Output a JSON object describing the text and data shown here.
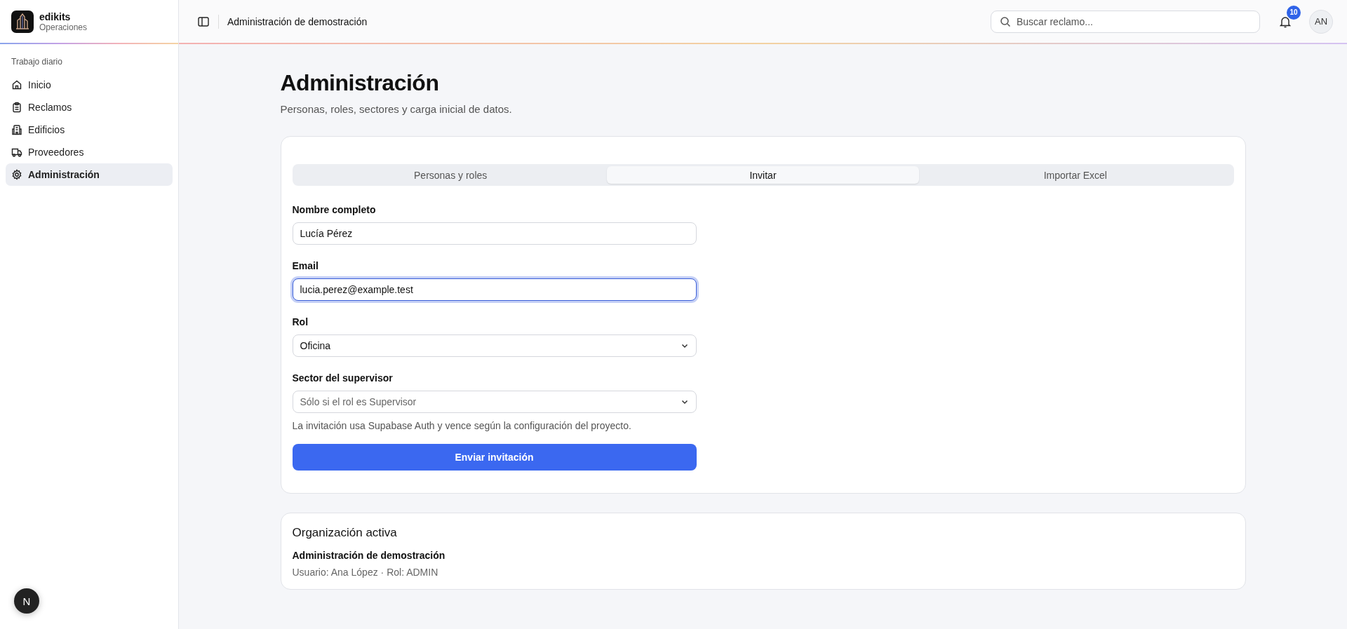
{
  "sidebar": {
    "brand": {
      "name": "edikits",
      "subtitle": "Operaciones"
    },
    "section": "Trabajo diario",
    "items": [
      {
        "label": "Inicio",
        "selected": false
      },
      {
        "label": "Reclamos",
        "selected": false
      },
      {
        "label": "Edificios",
        "selected": false
      },
      {
        "label": "Proveedores",
        "selected": false
      },
      {
        "label": "Administración",
        "selected": true
      }
    ]
  },
  "topbar": {
    "breadcrumb": "Administración de demostración",
    "search": {
      "placeholder": "Buscar reclamo..."
    },
    "notifications": "10",
    "avatar": "AN"
  },
  "page": {
    "title": "Administración",
    "subtitle": "Personas, roles, sectores y carga inicial de datos."
  },
  "tabs": [
    {
      "label": "Personas y roles",
      "selected": false
    },
    {
      "label": "Invitar",
      "selected": true
    },
    {
      "label": "Importar Excel",
      "selected": false
    }
  ],
  "form": {
    "fields": [
      {
        "kind": "input",
        "label": "Nombre completo",
        "value": "Lucía Pérez",
        "focused": false
      },
      {
        "kind": "input",
        "label": "Email",
        "value": "lucia.perez@example.test",
        "focused": true
      },
      {
        "kind": "select",
        "label": "Rol",
        "value": "Oficina",
        "focused": false
      },
      {
        "kind": "select",
        "label": "Sector del supervisor",
        "placeholder": "Sólo si el rol es Supervisor",
        "focused": false
      }
    ],
    "hint": "La invitación usa Supabase Auth y vence según la configuración del proyecto.",
    "submit": "Enviar invitación"
  },
  "organization": {
    "title": "Organización activa",
    "name": "Administración de demostración",
    "details": "Usuario: Ana López · Rol: ADMIN"
  },
  "dev_badge": "N"
}
